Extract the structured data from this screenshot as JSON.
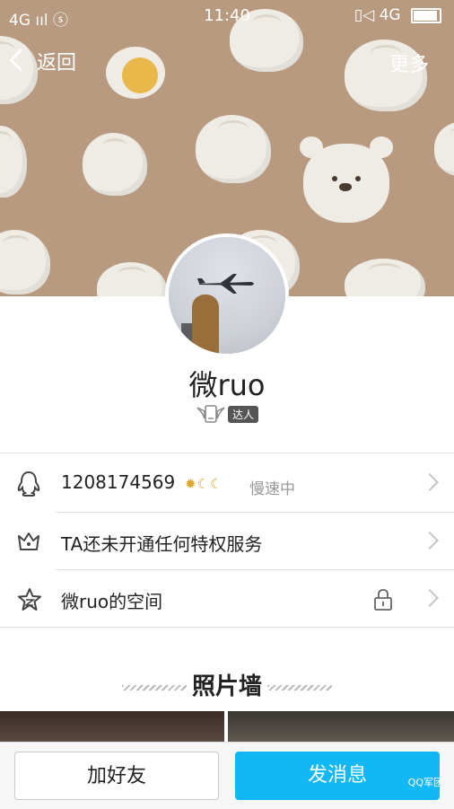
{
  "status_bar": {
    "left": "4G ııl  ⓢ",
    "time": "11:40",
    "right": "▯◁ 4G"
  },
  "nav": {
    "back_label": "返回",
    "more_label": "更多"
  },
  "profile": {
    "name": "微ruo",
    "badge": "达人"
  },
  "rows": {
    "qq_number": "1208174569",
    "level_icons": "✹☾☾",
    "online_status": "慢速中",
    "privilege": "TA还未开通任何特权服务",
    "space": "微ruo的空间"
  },
  "photo_wall": {
    "title": "照片墙"
  },
  "bottom": {
    "add_friend": "加好友",
    "send_message": "发消息",
    "watermark": "QQ军团"
  },
  "colors": {
    "header_bg": "#b79a7f",
    "primary_button": "#12b7f5"
  },
  "icons": [
    "back-chevron-icon",
    "qq-penguin-icon",
    "crown-icon",
    "star-space-icon",
    "lock-icon",
    "chevron-right-icon",
    "wing-phone-icon"
  ]
}
